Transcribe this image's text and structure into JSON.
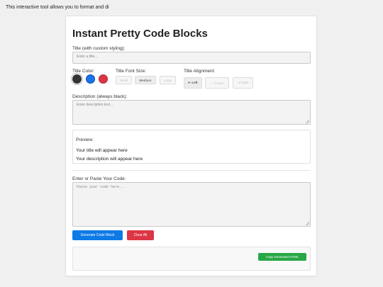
{
  "intro_text": "This interactive tool allows you to format and di",
  "title": "Instant Pretty Code Blocks",
  "title_field": {
    "label": "Title (with custom styling):",
    "placeholder": "Enter a title..."
  },
  "color": {
    "label": "Title Color:",
    "options": [
      "#333333",
      "#1a73e8",
      "#dc3545"
    ],
    "selected": "#333333"
  },
  "font_size": {
    "label": "Title Font Size:",
    "options": [
      "Small",
      "Medium",
      "Large"
    ],
    "selected": "Medium"
  },
  "alignment": {
    "label": "Title Alignment:",
    "options": [
      "⇤ Left",
      "⇔ Center",
      "⇥ Right"
    ],
    "selected": "Left"
  },
  "description": {
    "label": "Description (always black):",
    "placeholder": "Enter description text..."
  },
  "preview": {
    "label": "Preview:",
    "title": "Your title will appear here",
    "description": "Your description will appear here"
  },
  "code": {
    "label": "Enter or Paste Your Code:",
    "placeholder": "Paste your code here..."
  },
  "buttons": {
    "generate": "Generate Code Block",
    "clear": "Clear All",
    "copy": "Copy Generated HTML"
  },
  "colors": {
    "primary": "#0d7ae6",
    "danger": "#dc3545",
    "success": "#28a745"
  }
}
